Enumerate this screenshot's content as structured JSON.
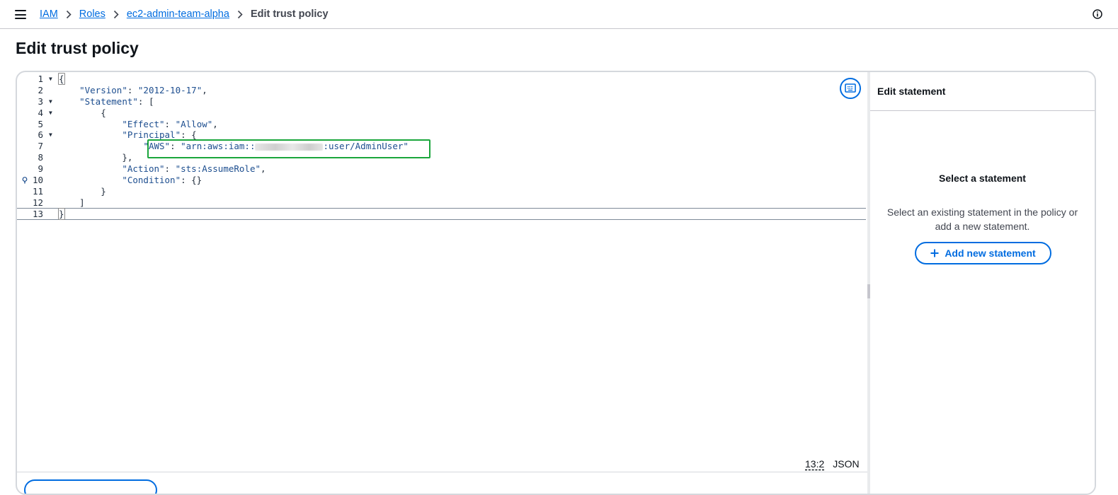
{
  "breadcrumb": {
    "items": [
      "IAM",
      "Roles",
      "ec2-admin-team-alpha"
    ],
    "current": "Edit trust policy"
  },
  "page": {
    "title": "Edit trust policy"
  },
  "editor": {
    "line_numbers": [
      "1",
      "2",
      "3",
      "4",
      "5",
      "6",
      "7",
      "8",
      "9",
      "10",
      "11",
      "12",
      "13"
    ],
    "lines": {
      "l1": "{",
      "l2_key": "\"Version\"",
      "l2_val": "\"2012-10-17\"",
      "l3_key": "\"Statement\"",
      "l3_rest": ": [",
      "l4": "{",
      "l5_key": "\"Effect\"",
      "l5_val": "\"Allow\"",
      "l6_key": "\"Principal\"",
      "l6_rest": ": {",
      "l7_key": "\"AWS\"",
      "l7_val_pre": "\"arn:aws:iam::",
      "l7_val_post": ":user/AdminUser\"",
      "l8": "},",
      "l9_key": "\"Action\"",
      "l9_val": "\"sts:AssumeRole\"",
      "l10_key": "\"Condition\"",
      "l10_rest": ": {}",
      "l11": "}",
      "l12": "]",
      "l13": "}"
    },
    "status": {
      "position": "13:2",
      "language": "JSON"
    }
  },
  "side_panel": {
    "header": "Edit statement",
    "empty_title": "Select a statement",
    "empty_desc": "Select an existing statement in the policy or add a new statement.",
    "add_button": "Add new statement"
  },
  "colors": {
    "accent": "#006ce0",
    "highlight": "#1aa63c"
  },
  "icons": [
    "menu-icon",
    "chevron-right-icon",
    "info-icon",
    "keyboard-icon",
    "plus-icon",
    "lightbulb-icon"
  ]
}
